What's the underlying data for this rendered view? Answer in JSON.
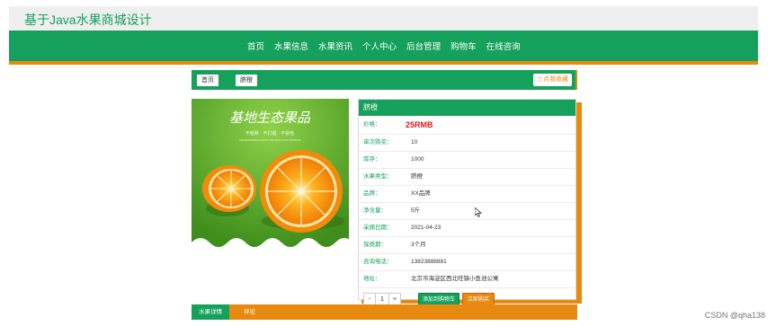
{
  "site": {
    "title": "基于Java水果商城设计"
  },
  "nav": {
    "items": [
      "首页",
      "水果信息",
      "水果资讯",
      "个人中心",
      "后台管理",
      "购物车",
      "在线咨询"
    ]
  },
  "breadcrumb": {
    "home": "首页",
    "current": "脐橙",
    "favorite": "☆点我收藏"
  },
  "product_image": {
    "headline": "基地生态果品",
    "subline": "不催熟 · 不打蜡 · 不染色",
    "subline_small": "CHANGSHENGGUOYE TOP HOT SALE SEASON"
  },
  "product": {
    "name": "脐橙",
    "price_label": "价格：",
    "price": "25RMB",
    "rows": [
      {
        "label": "单次购买：",
        "value": "10"
      },
      {
        "label": "库存：",
        "value": "1000"
      },
      {
        "label": "水果类型：",
        "value": "脐橙"
      },
      {
        "label": "品牌：",
        "value": "XX品牌"
      },
      {
        "label": "净含量：",
        "value": "5斤"
      },
      {
        "label": "采摘日期：",
        "value": "2021-04-23"
      },
      {
        "label": "保质期：",
        "value": "3个月"
      },
      {
        "label": "咨询电话：",
        "value": "13823888881"
      },
      {
        "label": "地址：",
        "value": "北京市海淀区西北旺镇小鱼池公寓"
      }
    ]
  },
  "actions": {
    "minus": "-",
    "quantity": "1",
    "plus": "+",
    "add_to_cart": "添加到购物车",
    "buy_now": "立即购买"
  },
  "tabs": {
    "details": "水果详情",
    "comments": "评论"
  },
  "watermark": "CSDN @qha138",
  "colors": {
    "green": "#15a15c",
    "orange": "#e88a12",
    "price_red": "#d42020"
  }
}
